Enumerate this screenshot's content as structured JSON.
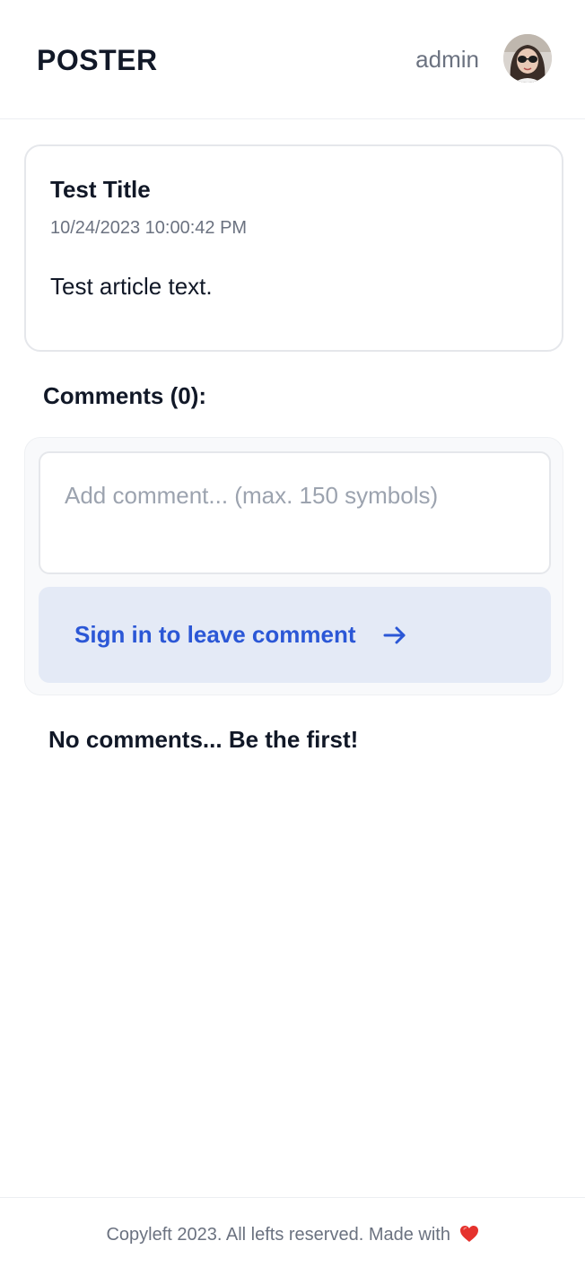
{
  "header": {
    "logo": "POSTER",
    "username": "admin"
  },
  "article": {
    "title": "Test Title",
    "date": "10/24/2023 10:00:42 PM",
    "text": "Test article text."
  },
  "comments": {
    "heading": "Comments (0):",
    "input_placeholder": "Add comment... (max. 150 symbols)",
    "signin_label": "Sign in to leave comment",
    "empty_message": "No comments... Be the first!"
  },
  "footer": {
    "text": "Copyleft 2023. All lefts reserved. Made with"
  },
  "icons": {
    "signin_arrow": "arrow-right-icon",
    "footer_heart": "heart-icon"
  },
  "colors": {
    "accent": "#2b57d6",
    "accent_bg": "#e4eaf6",
    "heart": "#e5322d"
  }
}
